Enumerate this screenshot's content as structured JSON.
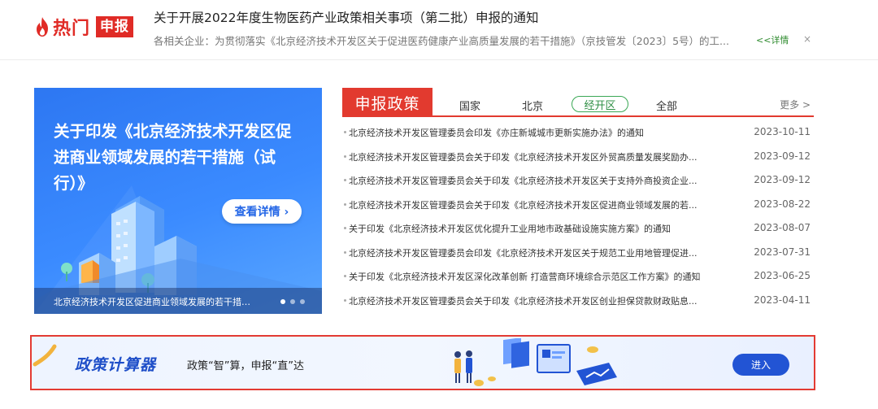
{
  "hot": {
    "label": "热门",
    "badge": "申报",
    "title": "关于开展2022年度生物医药产业政策相关事项（第二批）申报的通知",
    "summary": "各相关企业：为贯彻落实《北京经济技术开发区关于促进医药健康产业高质量发展的若干措施》（京技管发〔2023〕5号）的工...",
    "more": "<<详情",
    "close": "×"
  },
  "banner": {
    "title": "关于印发《北京经济技术开发区促进商业领域发展的若干措施（试行）》",
    "button": "查看详情 ›",
    "caption": "北京经济技术开发区促进商业领域发展的若干措施...",
    "slides": 3,
    "active_slide": 1
  },
  "policy": {
    "heading": "申报政策",
    "tabs": [
      "国家",
      "北京",
      "经开区",
      "全部"
    ],
    "active_tab": "经开区",
    "more": "更多 >",
    "items": [
      {
        "title": "北京经济技术开发区管理委员会印发《亦庄新城城市更新实施办法》的通知",
        "date": "2023-10-11"
      },
      {
        "title": "北京经济技术开发区管理委员会关于印发《北京经济技术开发区外贸高质量发展奖励办...",
        "date": "2023-09-12"
      },
      {
        "title": "北京经济技术开发区管理委员会关于印发《北京经济技术开发区关于支持外商投资企业...",
        "date": "2023-09-12"
      },
      {
        "title": "北京经济技术开发区管理委员会关于印发《北京经济技术开发区促进商业领域发展的若...",
        "date": "2023-08-22"
      },
      {
        "title": "关于印发《北京经济技术开发区优化提升工业用地市政基础设施实施方案》的通知",
        "date": "2023-08-07"
      },
      {
        "title": "北京经济技术开发区管理委员会印发《北京经济技术开发区关于规范工业用地管理促进...",
        "date": "2023-07-31"
      },
      {
        "title": "关于印发《北京经济技术开发区深化改革创新 打造营商环境综合示范区工作方案》的通知",
        "date": "2023-06-25"
      },
      {
        "title": "北京经济技术开发区管理委员会关于印发《北京经济技术开发区创业担保贷款财政贴息...",
        "date": "2023-04-11"
      }
    ]
  },
  "calculator": {
    "title": "政策计算器",
    "slogan": "政策“智”算，申报“直”达",
    "button": "进入"
  },
  "colors": {
    "brand_red": "#e02b26",
    "accent_blue": "#2254d4",
    "active_green": "#3aa855"
  }
}
